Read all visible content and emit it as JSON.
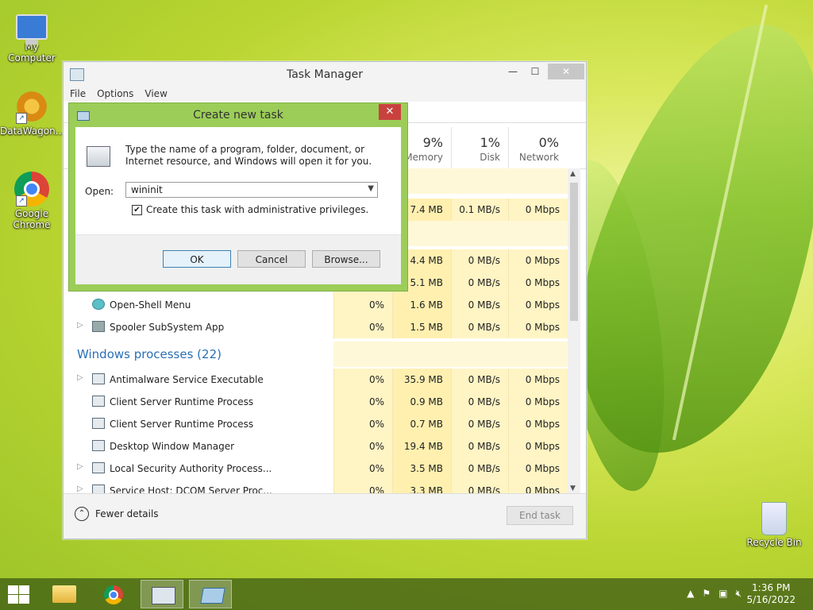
{
  "desktop": {
    "icons": [
      {
        "label": "My Computer"
      },
      {
        "label": "DataWagon..."
      },
      {
        "label": "Google Chrome"
      },
      {
        "label": "Recycle Bin"
      }
    ]
  },
  "task_manager": {
    "title": "Task Manager",
    "menu": [
      "File",
      "Options",
      "View"
    ],
    "columns": {
      "memory": {
        "pct": "9%",
        "name": "Memory"
      },
      "disk": {
        "pct": "1%",
        "name": "Disk"
      },
      "network": {
        "pct": "0%",
        "name": "Network"
      }
    },
    "rows": [
      {
        "name": "",
        "cpu": "",
        "mem": "7.4 MB",
        "disk": "0.1 MB/s",
        "net": "0 Mbps"
      },
      {
        "name": "",
        "cpu": "",
        "mem": "4.4 MB",
        "disk": "0 MB/s",
        "net": "0 Mbps"
      },
      {
        "name": "",
        "cpu": "",
        "mem": "5.1 MB",
        "disk": "0 MB/s",
        "net": "0 Mbps"
      },
      {
        "name": "Open-Shell Menu",
        "cpu": "0%",
        "mem": "1.6 MB",
        "disk": "0 MB/s",
        "net": "0 Mbps"
      },
      {
        "name": "Spooler SubSystem App",
        "cpu": "0%",
        "mem": "1.5 MB",
        "disk": "0 MB/s",
        "net": "0 Mbps"
      }
    ],
    "group_title": "Windows processes (22)",
    "win_rows": [
      {
        "name": "Antimalware Service Executable",
        "cpu": "0%",
        "mem": "35.9 MB",
        "disk": "0 MB/s",
        "net": "0 Mbps"
      },
      {
        "name": "Client Server Runtime Process",
        "cpu": "0%",
        "mem": "0.9 MB",
        "disk": "0 MB/s",
        "net": "0 Mbps"
      },
      {
        "name": "Client Server Runtime Process",
        "cpu": "0%",
        "mem": "0.7 MB",
        "disk": "0 MB/s",
        "net": "0 Mbps"
      },
      {
        "name": "Desktop Window Manager",
        "cpu": "0%",
        "mem": "19.4 MB",
        "disk": "0 MB/s",
        "net": "0 Mbps"
      },
      {
        "name": "Local Security Authority Process...",
        "cpu": "0%",
        "mem": "3.5 MB",
        "disk": "0 MB/s",
        "net": "0 Mbps"
      },
      {
        "name": "Service Host: DCOM Server Proc...",
        "cpu": "0%",
        "mem": "3.3 MB",
        "disk": "0 MB/s",
        "net": "0 Mbps"
      }
    ],
    "fewer_details": "Fewer details",
    "end_task": "End task"
  },
  "dialog": {
    "title": "Create new task",
    "message": "Type the name of a program, folder, document, or Internet resource, and Windows will open it for you.",
    "open_label": "Open:",
    "open_value": "wininit",
    "admin_checkbox": "Create this task with administrative privileges.",
    "ok": "OK",
    "cancel": "Cancel",
    "browse": "Browse..."
  },
  "taskbar": {
    "time": "1:36 PM",
    "date": "5/16/2022"
  },
  "colors": {
    "accent_green": "#9ccd58",
    "link_blue": "#2a6fb5",
    "heat_yellow": "#fff4c4"
  }
}
